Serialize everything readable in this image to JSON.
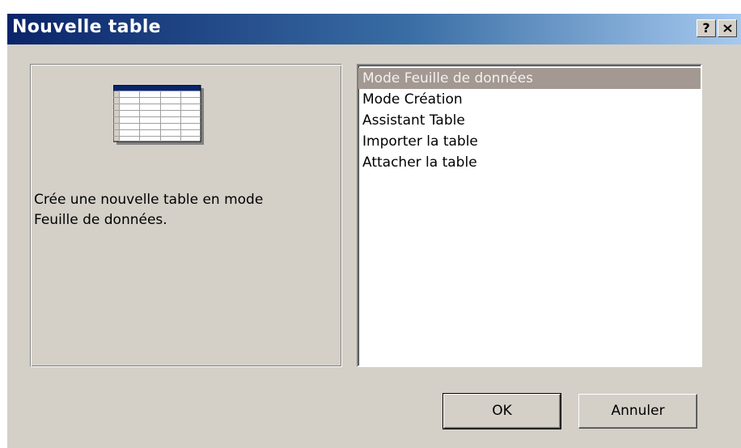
{
  "window": {
    "title": "Nouvelle table",
    "help_button": "?",
    "close_icon": "close-icon",
    "titlebar_color_start": "#0a246a",
    "titlebar_color_end": "#a6caf0",
    "background": "#d4d0c8"
  },
  "preview": {
    "icon": "datasheet-table-icon",
    "description": "Crée une nouvelle table en mode\nFeuille de données."
  },
  "list": {
    "items": [
      {
        "label": "Mode Feuille de données",
        "selected": true
      },
      {
        "label": "Mode Création",
        "selected": false
      },
      {
        "label": "Assistant Table",
        "selected": false
      },
      {
        "label": "Importer la table",
        "selected": false
      },
      {
        "label": "Attacher la table",
        "selected": false
      }
    ],
    "selection_color": "#a39892"
  },
  "buttons": {
    "ok_label": "OK",
    "cancel_label": "Annuler"
  }
}
